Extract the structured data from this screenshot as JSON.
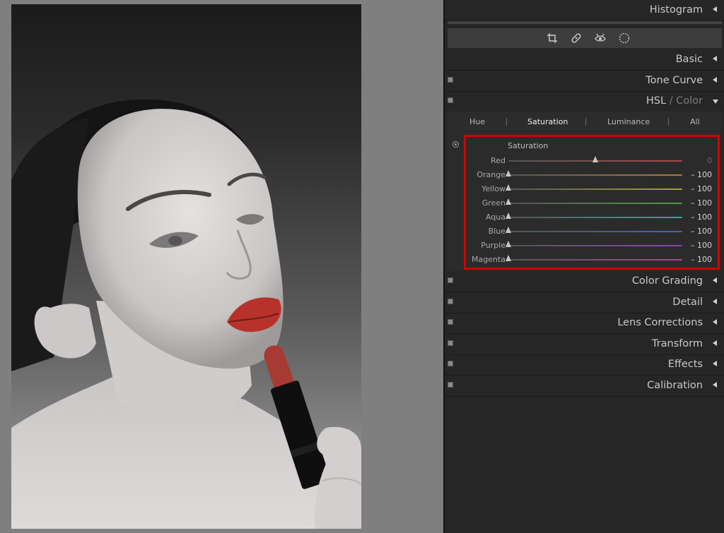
{
  "sections": {
    "histogram": "Histogram",
    "basic": "Basic",
    "tone_curve": "Tone Curve",
    "hsl_main": "HSL",
    "hsl_sep": " / ",
    "hsl_color": "Color",
    "color_grading": "Color Grading",
    "detail": "Detail",
    "lens_corrections": "Lens Corrections",
    "transform": "Transform",
    "effects": "Effects",
    "calibration": "Calibration"
  },
  "toolbar": {
    "icons": [
      "crop-icon",
      "healing-icon",
      "red-eye-icon",
      "mask-icon"
    ]
  },
  "hsl_tabs": [
    "Hue",
    "Saturation",
    "Luminance",
    "All"
  ],
  "active_tab": "Saturation",
  "saturation": {
    "title": "Saturation",
    "sliders": [
      {
        "label": "Red",
        "value": "0",
        "level": 0,
        "color": "#b04848"
      },
      {
        "label": "Orange",
        "value": "– 100",
        "level": -100,
        "color": "#b07a3a"
      },
      {
        "label": "Yellow",
        "value": "– 100",
        "level": -100,
        "color": "#a8a23a"
      },
      {
        "label": "Green",
        "value": "– 100",
        "level": -100,
        "color": "#4f9a45"
      },
      {
        "label": "Aqua",
        "value": "– 100",
        "level": -100,
        "color": "#3f9e9a"
      },
      {
        "label": "Blue",
        "value": "– 100",
        "level": -100,
        "color": "#3f66b0"
      },
      {
        "label": "Purple",
        "value": "– 100",
        "level": -100,
        "color": "#8a44b0"
      },
      {
        "label": "Magenta",
        "value": "– 100",
        "level": -100,
        "color": "#b0448a"
      }
    ]
  },
  "colors": {
    "panel_bg": "#262626",
    "highlight": "#d50000",
    "lipstick": "#b8322c"
  }
}
